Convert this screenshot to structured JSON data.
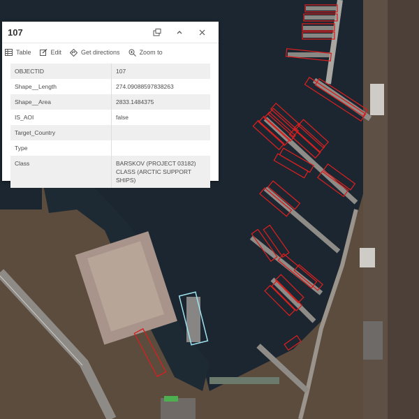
{
  "popup": {
    "title": "107",
    "actions": {
      "table": "Table",
      "edit": "Edit",
      "directions": "Get directions",
      "zoom": "Zoom to"
    },
    "rows": [
      {
        "key": "OBJECTID",
        "value": "107"
      },
      {
        "key": "Shape__Length",
        "value": "274.09088597838263"
      },
      {
        "key": "Shape__Area",
        "value": "2833.1484375"
      },
      {
        "key": "IS_AOI",
        "value": "false"
      },
      {
        "key": "Target_Country",
        "value": ""
      },
      {
        "key": "Type",
        "value": ""
      },
      {
        "key": "Class",
        "value": "BARSKOV (PROJECT 03182) CLASS (ARCTIC SUPPORT SHIPS)"
      }
    ]
  },
  "colors": {
    "detection": "#d42020",
    "selected": "#9fe3f0",
    "water": "#1b2630"
  }
}
